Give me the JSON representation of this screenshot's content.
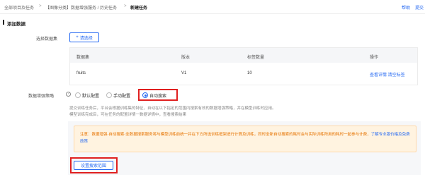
{
  "breadcrumb": {
    "items": [
      "全部项目及任务",
      "【图像分类】数据增强服务 / 历史任务",
      "新建任务"
    ],
    "separator": ">"
  },
  "top_links": {
    "help": "帮助",
    "submit": "提交"
  },
  "section": {
    "title": "添加数据"
  },
  "dataset": {
    "label": "选择数据集",
    "choose_button": "请选择",
    "plus_icon": "+",
    "columns": [
      "数据集",
      "版本",
      "标签数量",
      "操作"
    ],
    "rows": [
      {
        "name": "fruits",
        "version": "V1",
        "label_count": "10",
        "actions": "查看详情  清空标签"
      }
    ]
  },
  "strategy": {
    "label": "数据增强策略",
    "help_icon": "?",
    "options": [
      "默认配置",
      "手动配置",
      "自动搜索"
    ],
    "selected": "自动搜索",
    "desc_line1": "提交训练任务后，平台会根据训练集的特征，自动在以下指定的范围内搜索有效的数据增强策略，并在模型训练时应用。",
    "desc_line2": "模型训练完成后，可在任务的配置详情一数据详情中，查看搜索结果"
  },
  "notice": {
    "text": "注意：数据增强-自动搜索-全数据搜索服务将与模型训练前统一并在下方所选训练框架进行计算及训练，同时全新自动搜索的耗时会与实际训练所用的耗时一起参与计费，",
    "link": "了解专业版价格及免费政策"
  },
  "range_button": "设置搜索范围",
  "colors": {
    "accent": "#2468f2",
    "warning": "#e67300",
    "highlight": "#e02020"
  }
}
